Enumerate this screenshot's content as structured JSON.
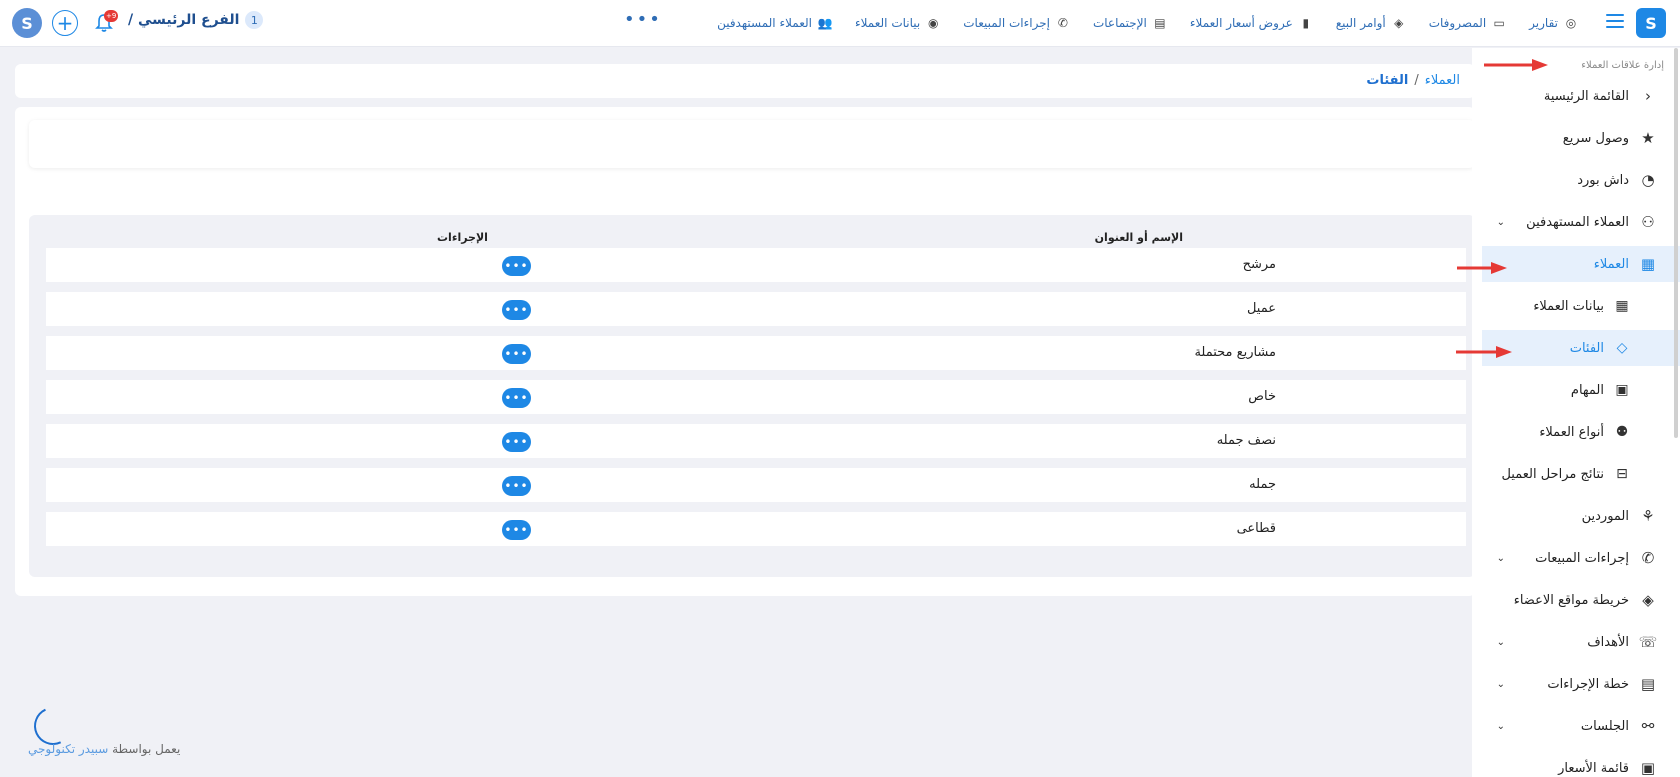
{
  "topbar": {
    "logo_letter": "S",
    "nav": [
      {
        "label": "العملاء المستهدفين",
        "icon": "target-customers-icon",
        "glyph": "👥"
      },
      {
        "label": "بيانات العملاء",
        "icon": "customer-data-icon",
        "glyph": "◉"
      },
      {
        "label": "إجراءات المبيعات",
        "icon": "phone-icon",
        "glyph": "✆"
      },
      {
        "label": "الإجتماعات",
        "icon": "meetings-icon",
        "glyph": "▤"
      },
      {
        "label": "عروض أسعار العملاء",
        "icon": "quote-icon",
        "glyph": "▮"
      },
      {
        "label": "أوامر البيع",
        "icon": "money-bag-icon",
        "glyph": "◈"
      },
      {
        "label": "المصروفات",
        "icon": "laptop-icon",
        "glyph": "▭"
      },
      {
        "label": "تقارير",
        "icon": "reports-icon",
        "glyph": "◎"
      }
    ],
    "more": "•••",
    "branch_name": "الفرع الرئيسي /",
    "branch_number": "1",
    "notification_badge": "+9",
    "plus": "+"
  },
  "breadcrumb": {
    "parent": "العملاء",
    "separator": "/",
    "current": "الفئات"
  },
  "table": {
    "headers": {
      "name": "الإسم أو العنوان",
      "actions": "الإجراءات"
    },
    "rows": [
      "مرشح",
      "عميل",
      "مشاريع محتملة",
      "خاص",
      "نصف جمله",
      "جمله",
      "قطاعى"
    ],
    "action_glyph": "•••"
  },
  "footer": {
    "text": "يعمل بواسطة",
    "company": "سبيدر تكنولوجي"
  },
  "sidebar": {
    "title": "إدارة علاقات العملاء",
    "items": [
      {
        "label": "القائمة الرئيسية",
        "icon": "chevron-left-icon",
        "glyph": "‹",
        "level": 0
      },
      {
        "label": "وصول سريع",
        "icon": "star-icon",
        "glyph": "★",
        "level": 0
      },
      {
        "label": "داش بورد",
        "icon": "dashboard-icon",
        "glyph": "◔",
        "level": 0
      },
      {
        "label": "العملاء المستهدفين",
        "icon": "target-customers-icon",
        "glyph": "⚇",
        "level": 0,
        "expandable": true
      },
      {
        "label": "العملاء",
        "icon": "building-icon",
        "glyph": "▦",
        "level": 0,
        "active": true
      },
      {
        "label": "بيانات العملاء",
        "icon": "building-icon",
        "glyph": "▦",
        "level": 1
      },
      {
        "label": "الفئات",
        "icon": "tag-icon",
        "glyph": "◇",
        "level": 1,
        "active": true
      },
      {
        "label": "المهام",
        "icon": "clipboard-icon",
        "glyph": "▣",
        "level": 1
      },
      {
        "label": "أنواع العملاء",
        "icon": "user-settings-icon",
        "glyph": "⚉",
        "level": 1
      },
      {
        "label": "نتائج مراحل العميل",
        "icon": "stages-icon",
        "glyph": "⊟",
        "level": 1
      },
      {
        "label": "الموردين",
        "icon": "suppliers-icon",
        "glyph": "⚘",
        "level": 0
      },
      {
        "label": "إجراءات المبيعات",
        "icon": "phone-icon",
        "glyph": "✆",
        "level": 0,
        "expandable": true
      },
      {
        "label": "خريطة مواقع الاعضاء",
        "icon": "location-icon",
        "glyph": "◈",
        "level": 0
      },
      {
        "label": "الأهداف",
        "icon": "goals-icon",
        "glyph": "☏",
        "level": 0,
        "expandable": true
      },
      {
        "label": "خطة الإجراءات",
        "icon": "plan-icon",
        "glyph": "▤",
        "level": 0,
        "expandable": true
      },
      {
        "label": "الجلسات",
        "icon": "sessions-icon",
        "glyph": "⚯",
        "level": 0,
        "expandable": true
      },
      {
        "label": "قائمة الأسعار",
        "icon": "price-list-icon",
        "glyph": "▣",
        "level": 0
      }
    ]
  },
  "colors": {
    "accent": "#1e88e5",
    "annotation_arrow": "#e53935",
    "background": "#f0f1f6"
  }
}
